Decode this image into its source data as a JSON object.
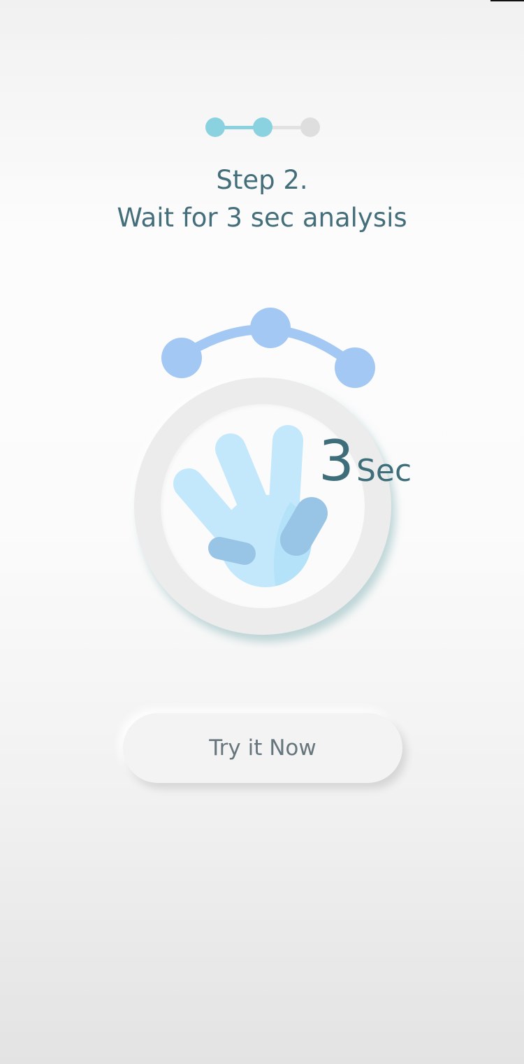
{
  "stepper": {
    "total_steps": 3,
    "current_step": 2
  },
  "header": {
    "step_label": "Step 2.",
    "instruction": "Wait for 3 sec analysis"
  },
  "timer": {
    "value": "3",
    "unit": "Sec"
  },
  "actions": {
    "try_label": "Try it Now"
  },
  "icons": {
    "illustration": "hand-scan-icon",
    "arc": "swipe-arc-icon"
  },
  "colors": {
    "accent": "#8ad2df",
    "inactive": "#dedede",
    "title_text": "#456e7b",
    "arc": "#a3c8f3",
    "hand_light": "#c3e8fb",
    "hand_dark": "#98c4e6"
  }
}
